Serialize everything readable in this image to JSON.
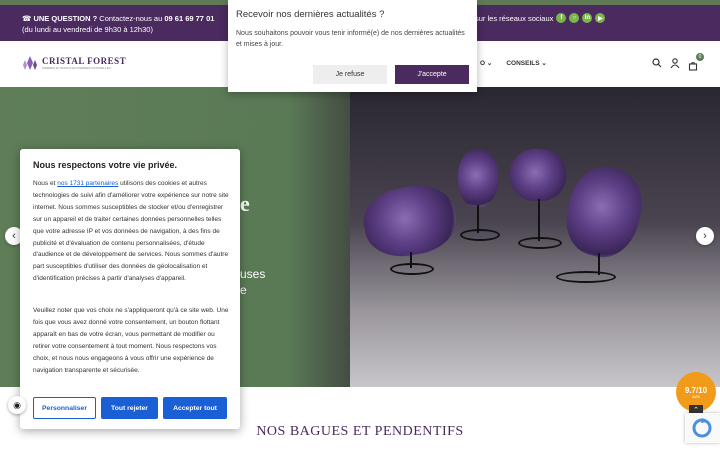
{
  "topbar": {
    "question_label": "UNE QUESTION ?",
    "contact_text": "Contactez-nous au",
    "phone": "09 61 69 77 01",
    "hours": "(du lundi au vendredi de 9h30 à 12h30)",
    "social_text": "sur les réseaux sociaux",
    "social_icons": [
      "facebook-icon",
      "instagram-icon",
      "linkedin-icon",
      "youtube-icon"
    ]
  },
  "header": {
    "logo_name": "CRISTAL FOREST",
    "logo_tagline": "PIERRES ET BIJOUX EN PIERRES NATURELLES",
    "nav": [
      {
        "label": "O"
      },
      {
        "label": "CONSEILS"
      }
    ],
    "cart_count": "0"
  },
  "hero": {
    "partial_word_1": "e",
    "partial_word_2": "uses",
    "partial_word_3": "e"
  },
  "section": {
    "title": "NOS BAGUES ET PENDENTIFS"
  },
  "notification": {
    "title": "Recevoir nos dernières actualités ?",
    "body": "Nous souhaitons pouvoir vous tenir informé(e) de nos dernières actualités et mises à jour.",
    "refuse_label": "Je refuse",
    "accept_label": "J'accepte"
  },
  "cookie": {
    "title": "Nous respectons votre vie privée.",
    "p1_before": "Nous et ",
    "p1_link": "nos 1731 partenaires",
    "p1_after": " utilisons des cookies et autres technologies de suivi afin d'améliorer votre expérience sur notre site internet. Nous sommes susceptibles de stocker et/ou d'enregistrer sur un appareil et de traiter certaines données personnelles telles que votre adresse IP et vos données de navigation, à des fins de publicité et d'évaluation de contenu personnalisées, d'étude d'audience et de développement de services. Nous sommes d'autre part susceptibles d'utiliser des données de géolocalisation et d'identification précises à partir d'analyses d'appareil.",
    "p2": "Veuillez noter que vos choix ne s'appliqueront qu'à ce site web. Une fois que vous avez donné votre consentement, un bouton flottant apparaît en bas de votre écran, vous permettant de modifier ou retirer votre consentement à tout moment. Nous respectons vos choix, et nous nous engageons à vous offrir une expérience de navigation transparente et sécurisée.",
    "customize_label": "Personnaliser",
    "reject_label": "Tout rejeter",
    "accept_label": "Accepter tout"
  },
  "rating_badge": {
    "score": "9.7/10",
    "brand": "AVIS"
  }
}
